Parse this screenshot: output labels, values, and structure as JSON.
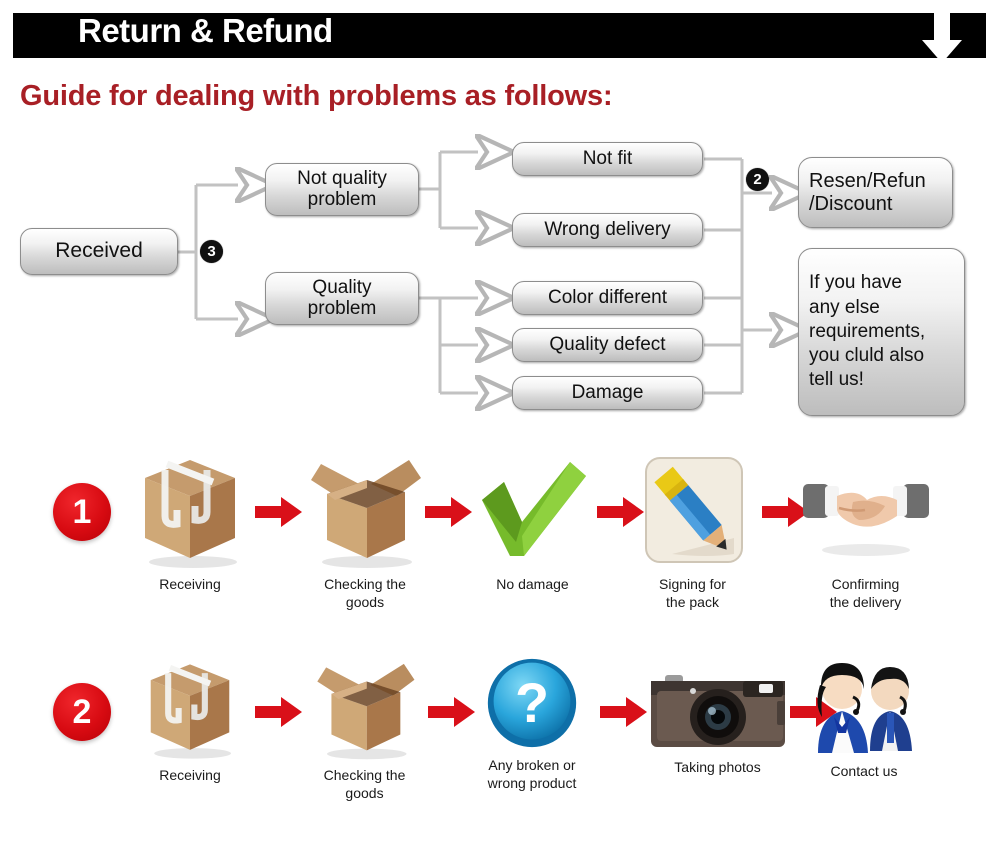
{
  "header": {
    "title": "Return & Refund",
    "arrow_icon": "down-arrow-icon",
    "bar_color": "#000000",
    "title_color": "#ffffff"
  },
  "guide": {
    "heading": "Guide for dealing with problems as follows:",
    "heading_color": "#a81f25"
  },
  "flowchart": {
    "nodes": {
      "received": "Received",
      "not_quality_problem": "Not quality\nproblem",
      "quality_problem": "Quality\nproblem",
      "not_fit": "Not fit",
      "wrong_delivery": "Wrong delivery",
      "color_different": "Color different",
      "quality_defect": "Quality defect",
      "damage": "Damage",
      "resend_refund": "Resen/Refun\n/Discount",
      "any_else": "If you have\nany else\nrequirements,\nyou cluld also\ntell us!"
    },
    "badges": {
      "branch_three": "3",
      "branch_two": "2"
    }
  },
  "process_rows": [
    {
      "badge": "1",
      "steps": [
        {
          "icon": "closed-box-icon",
          "caption": "Receiving"
        },
        {
          "icon": "open-box-icon",
          "caption": "Checking the\ngoods"
        },
        {
          "icon": "green-check-icon",
          "caption": "No damage"
        },
        {
          "icon": "pencil-signing-icon",
          "caption": "Signing for\nthe pack"
        },
        {
          "icon": "handshake-icon",
          "caption": "Confirming\nthe delivery"
        }
      ]
    },
    {
      "badge": "2",
      "steps": [
        {
          "icon": "closed-box-icon",
          "caption": "Receiving"
        },
        {
          "icon": "open-box-icon",
          "caption": "Checking the\ngoods"
        },
        {
          "icon": "blue-question-icon",
          "caption": "Any broken or\nwrong product"
        },
        {
          "icon": "camera-icon",
          "caption": "Taking photos"
        },
        {
          "icon": "support-agents-icon",
          "caption": "Contact us"
        }
      ]
    }
  ],
  "colors": {
    "red_arrow": "#d91019",
    "red_badge": "#d80b12",
    "box_border": "#8d8d8d"
  }
}
